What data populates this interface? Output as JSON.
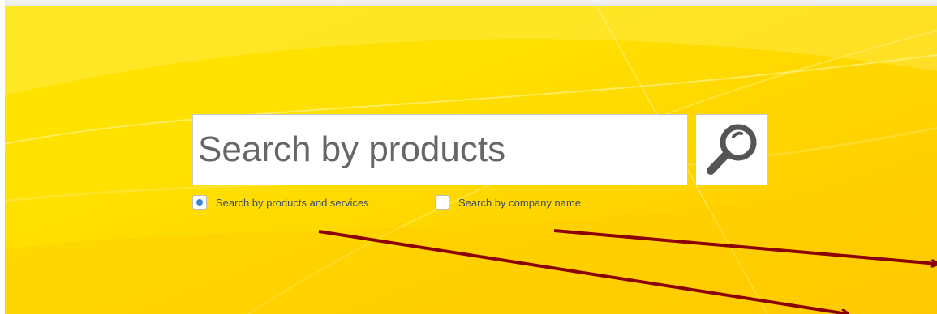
{
  "search": {
    "placeholder": "Search by products",
    "button_icon": "magnifier-icon"
  },
  "options": [
    {
      "label": "Search by products and services",
      "selected": true
    },
    {
      "label": "Search by company name",
      "selected": false
    }
  ],
  "colors": {
    "background": "#ffe000",
    "accent_dot": "#3b86d6",
    "arrow": "#8b0000",
    "search_icon": "#555555"
  }
}
